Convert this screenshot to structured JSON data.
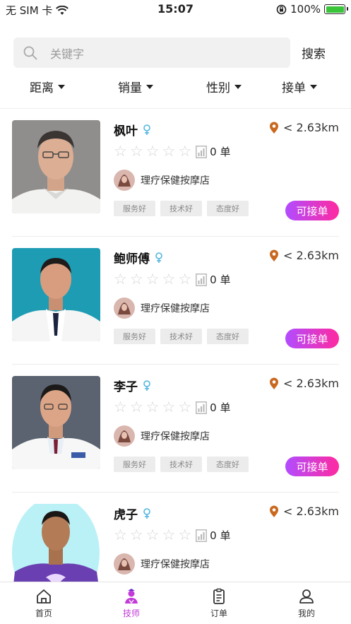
{
  "status_bar": {
    "carrier": "无 SIM 卡",
    "time": "15:07",
    "battery": "100%"
  },
  "search": {
    "placeholder": "关键字",
    "button": "搜索"
  },
  "filters": [
    "距离",
    "销量",
    "性别",
    "接单"
  ],
  "technicians": [
    {
      "name": "枫叶",
      "distance": "< 2.63km",
      "orders": "0 单",
      "shop": "理疗保健按摩店",
      "tags": [
        "服务好",
        "技术好",
        "态度好"
      ],
      "action": "可接单"
    },
    {
      "name": "鲍师傅",
      "distance": "< 2.63km",
      "orders": "0 单",
      "shop": "理疗保健按摩店",
      "tags": [
        "服务好",
        "技术好",
        "态度好"
      ],
      "action": "可接单"
    },
    {
      "name": "李子",
      "distance": "< 2.63km",
      "orders": "0 单",
      "shop": "理疗保健按摩店",
      "tags": [
        "服务好",
        "技术好",
        "态度好"
      ],
      "action": "可接单"
    },
    {
      "name": "虎子",
      "distance": "< 2.63km",
      "orders": "0 单",
      "shop": "理疗保健按摩店",
      "tags": [],
      "action": ""
    }
  ],
  "tabbar": [
    {
      "label": "首页",
      "icon": "home-icon"
    },
    {
      "label": "技师",
      "icon": "technician-icon"
    },
    {
      "label": "订单",
      "icon": "order-icon"
    },
    {
      "label": "我的",
      "icon": "profile-icon"
    }
  ],
  "colors": {
    "accent_start": "#b14cff",
    "accent_end": "#ff2aa0",
    "active_tab": "#c23bd8",
    "female_icon": "#4fb6e0",
    "location_pin": "#c9681f"
  }
}
